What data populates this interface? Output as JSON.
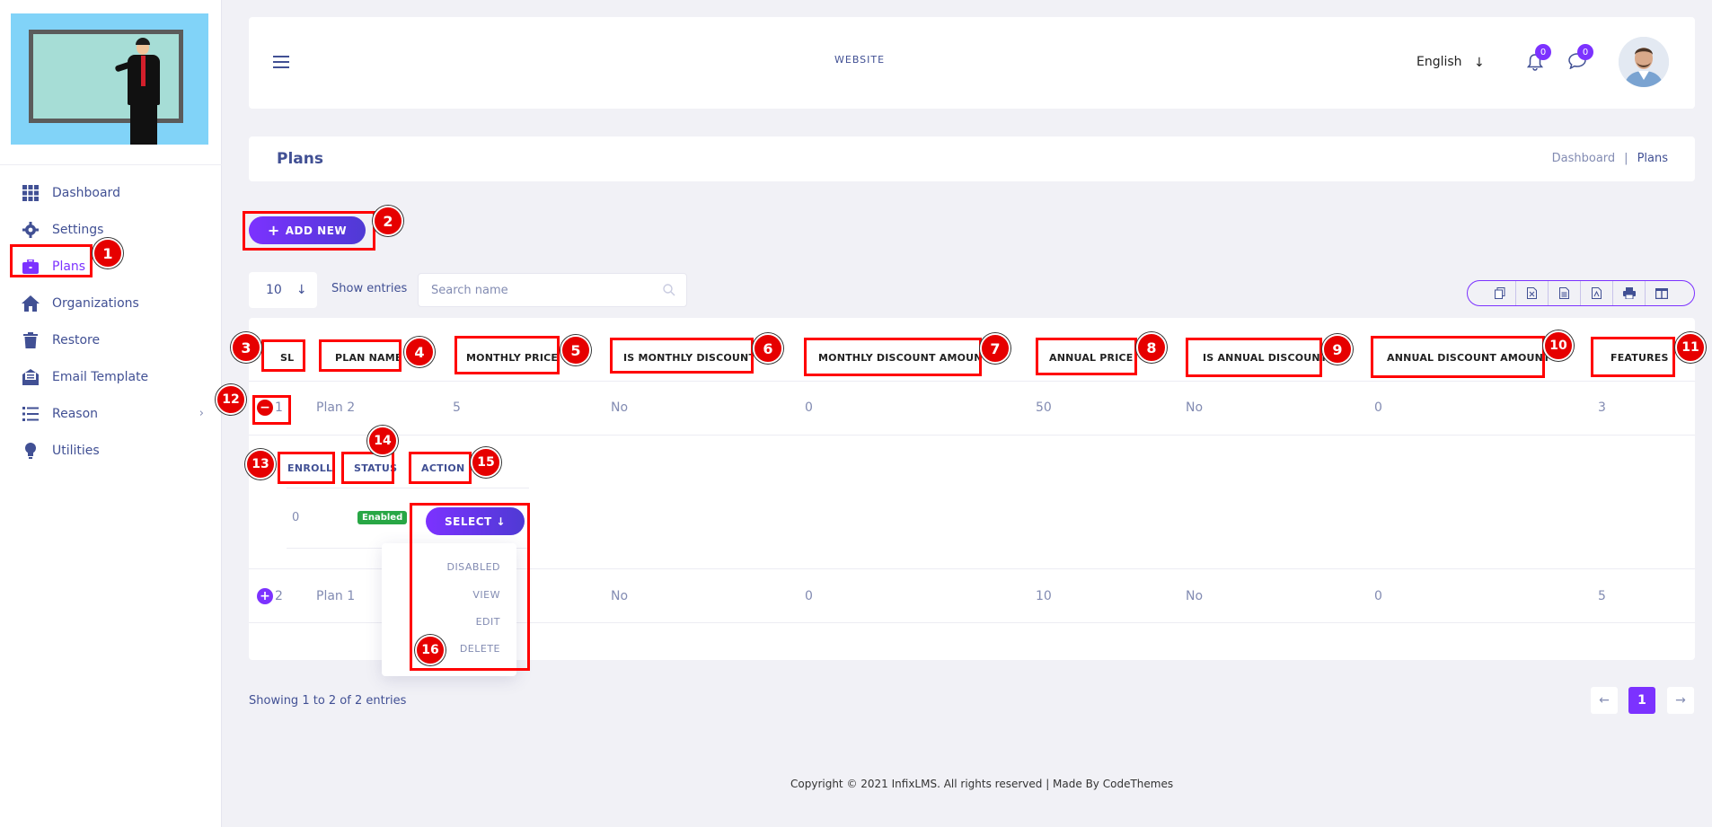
{
  "sidebar": {
    "items": [
      {
        "label": "Dashboard",
        "icon": "grid-icon"
      },
      {
        "label": "Settings",
        "icon": "gear-icon"
      },
      {
        "label": "Plans",
        "icon": "briefcase-icon",
        "active": true
      },
      {
        "label": "Organizations",
        "icon": "home-icon"
      },
      {
        "label": "Restore",
        "icon": "trash-icon"
      },
      {
        "label": "Email Template",
        "icon": "email-icon"
      },
      {
        "label": "Reason",
        "icon": "list-icon",
        "has_children": true
      },
      {
        "label": "Utilities",
        "icon": "bulb-icon"
      }
    ]
  },
  "header": {
    "website_label": "WEBSITE",
    "language": "English",
    "notifications_count": "0",
    "messages_count": "0"
  },
  "page": {
    "title": "Plans",
    "breadcrumb": [
      "Dashboard",
      "Plans"
    ]
  },
  "toolbar": {
    "add_new_label": "ADD NEW",
    "page_length": "10",
    "show_entries_label": "Show entries",
    "search_placeholder": "Search name"
  },
  "table": {
    "columns": [
      "SL",
      "PLAN NAME",
      "MONTHLY PRICE",
      "IS MONTHLY DISCOUNT",
      "MONTHLY DISCOUNT AMOUNT",
      "ANNUAL PRICE",
      "IS ANNUAL DISCOUNT",
      "ANNUAL DISCOUNT AMOUNT",
      "FEATURES"
    ],
    "rows": [
      {
        "sl": "1",
        "plan_name": "Plan 2",
        "monthly_price": "5",
        "is_monthly_discount": "No",
        "monthly_discount_amount": "0",
        "annual_price": "50",
        "is_annual_discount": "No",
        "annual_discount_amount": "0",
        "features": "3",
        "expanded": true
      },
      {
        "sl": "2",
        "plan_name": "Plan 1",
        "monthly_price": "",
        "is_monthly_discount": "No",
        "monthly_discount_amount": "0",
        "annual_price": "10",
        "is_annual_discount": "No",
        "annual_discount_amount": "0",
        "features": "5",
        "expanded": false
      }
    ],
    "child": {
      "columns": [
        "ENROLL",
        "STATUS",
        "ACTION"
      ],
      "enroll": "0",
      "status": "Enabled",
      "action_label": "SELECT",
      "action_menu": [
        "DISABLED",
        "VIEW",
        "EDIT",
        "DELETE"
      ]
    }
  },
  "pagination": {
    "info": "Showing 1 to 2 of 2 entries",
    "current_page": "1"
  },
  "footer": {
    "copyright": "Copyright © 2021 InfixLMS. All rights reserved | Made By CodeThemes"
  },
  "annotations": [
    "1",
    "2",
    "3",
    "4",
    "5",
    "6",
    "7",
    "8",
    "9",
    "10",
    "11",
    "12",
    "13",
    "14",
    "15",
    "16"
  ],
  "colors": {
    "accent": "#7c32ff",
    "text": "#415094",
    "muted": "#828bb2",
    "marker": "#e60000",
    "enabled": "#28a745"
  }
}
